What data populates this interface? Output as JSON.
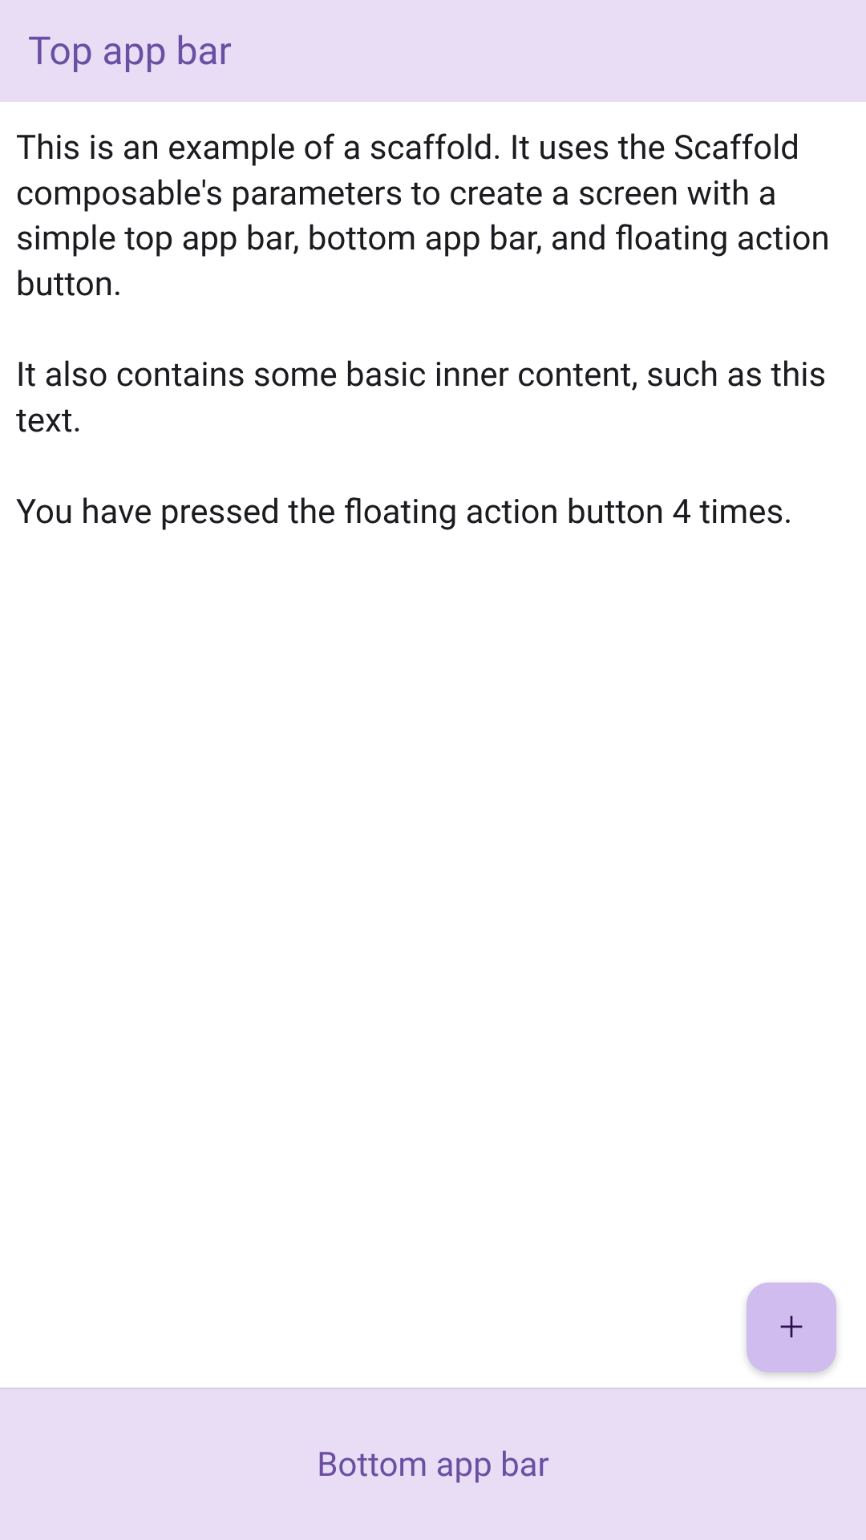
{
  "topBar": {
    "title": "Top app bar"
  },
  "content": {
    "body": "This is an example of a scaffold. It uses the Scaffold composable's parameters to create a screen with a simple top app bar, bottom app bar, and floating action button.\n\nIt also contains some basic inner content, such as this text.\n\nYou have pressed the floating action button 4 times."
  },
  "bottomBar": {
    "label": "Bottom app bar"
  },
  "fab": {
    "pressCount": 4
  },
  "colors": {
    "barBackground": "#e8ddf5",
    "barText": "#6a4fa3",
    "bodyText": "#1c1b1f",
    "fabBackground": "#d0bcef",
    "fabIcon": "#2a0f4a"
  }
}
